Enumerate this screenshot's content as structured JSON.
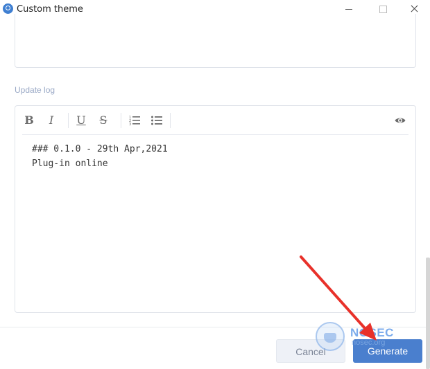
{
  "window": {
    "title": "Custom theme"
  },
  "form": {
    "update_log_label": "Update log"
  },
  "editor": {
    "toolbar": {
      "bold": "B",
      "italic": "I",
      "underline": "U",
      "strikethrough": "S",
      "ordered_list_icon": "ordered-list-icon",
      "unordered_list_icon": "unordered-list-icon",
      "preview_icon": "eye-icon"
    },
    "content": {
      "line1": "### 0.1.0 - 29th Apr,2021",
      "line2": "Plug-in online"
    }
  },
  "footer": {
    "cancel_label": "Cancel",
    "generate_label": "Generate"
  },
  "watermark": {
    "name": "NOSEC",
    "domain": "nosec.org"
  },
  "colors": {
    "accent": "#4a7fce",
    "annotation_arrow": "#e8312a",
    "label": "#9aa9c6"
  }
}
